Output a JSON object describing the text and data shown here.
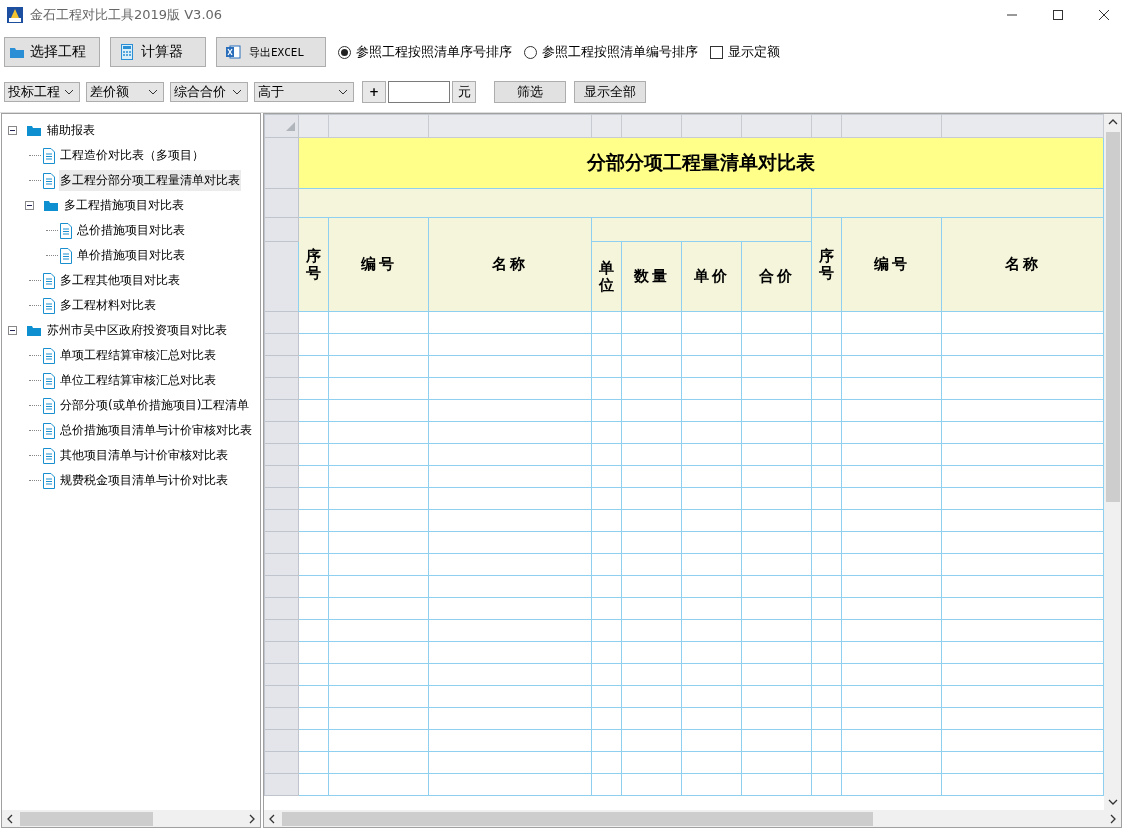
{
  "window": {
    "title": "金石工程对比工具2019版 V3.06"
  },
  "toolbar": {
    "buttons": [
      {
        "label": "选择工程",
        "kind": "folder"
      },
      {
        "label": "计算器",
        "kind": "calculator"
      },
      {
        "label": "导出EXCEL",
        "kind": "excel"
      }
    ],
    "sort_options": [
      {
        "label": "参照工程按照清单序号排序",
        "selected": true
      },
      {
        "label": "参照工程按照清单编号排序",
        "selected": false
      }
    ],
    "show_quota": {
      "label": "显示定额",
      "checked": false
    }
  },
  "filter_bar": {
    "dropdowns": [
      {
        "value": "投标工程"
      },
      {
        "value": "差价额"
      },
      {
        "value": "综合合价"
      },
      {
        "value": "高于"
      }
    ],
    "sign_button": "+",
    "unit": "元",
    "buttons": [
      "筛选",
      "显示全部"
    ]
  },
  "tree": [
    {
      "label": "辅助报表",
      "expanded": true,
      "selected": false,
      "children": [
        {
          "label": "工程造价对比表（多项目）",
          "selected": false
        },
        {
          "label": "多工程分部分项工程量清单对比表",
          "selected": true
        },
        {
          "label": "多工程措施项目对比表",
          "expanded": true,
          "selected": false,
          "children": [
            {
              "label": "总价措施项目对比表",
              "selected": false
            },
            {
              "label": "单价措施项目对比表",
              "selected": false
            }
          ]
        },
        {
          "label": "多工程其他项目对比表",
          "selected": false
        },
        {
          "label": "多工程材料对比表",
          "selected": false
        }
      ]
    },
    {
      "label": "苏州市吴中区政府投资项目对比表",
      "expanded": true,
      "selected": false,
      "children": [
        {
          "label": "单项工程结算审核汇总对比表",
          "selected": false
        },
        {
          "label": "单位工程结算审核汇总对比表",
          "selected": false
        },
        {
          "label": "分部分项(或单价措施项目)工程清单",
          "selected": false
        },
        {
          "label": "总价措施项目清单与计价审核对比表",
          "selected": false
        },
        {
          "label": "其他项目清单与计价审核对比表",
          "selected": false
        },
        {
          "label": "规费税金项目清单与计价对比表",
          "selected": false
        }
      ]
    }
  ],
  "grid": {
    "title": "分部分项工程量清单对比表",
    "left_columns": [
      {
        "label": "序号"
      },
      {
        "label": "编号"
      },
      {
        "label": "名称"
      }
    ],
    "price_columns": [
      {
        "label": "单位"
      },
      {
        "label": "数量"
      },
      {
        "label": "单价"
      },
      {
        "label": "合价"
      }
    ],
    "right_columns": [
      {
        "label": "序号"
      },
      {
        "label": "编号"
      },
      {
        "label": "名称"
      }
    ]
  }
}
